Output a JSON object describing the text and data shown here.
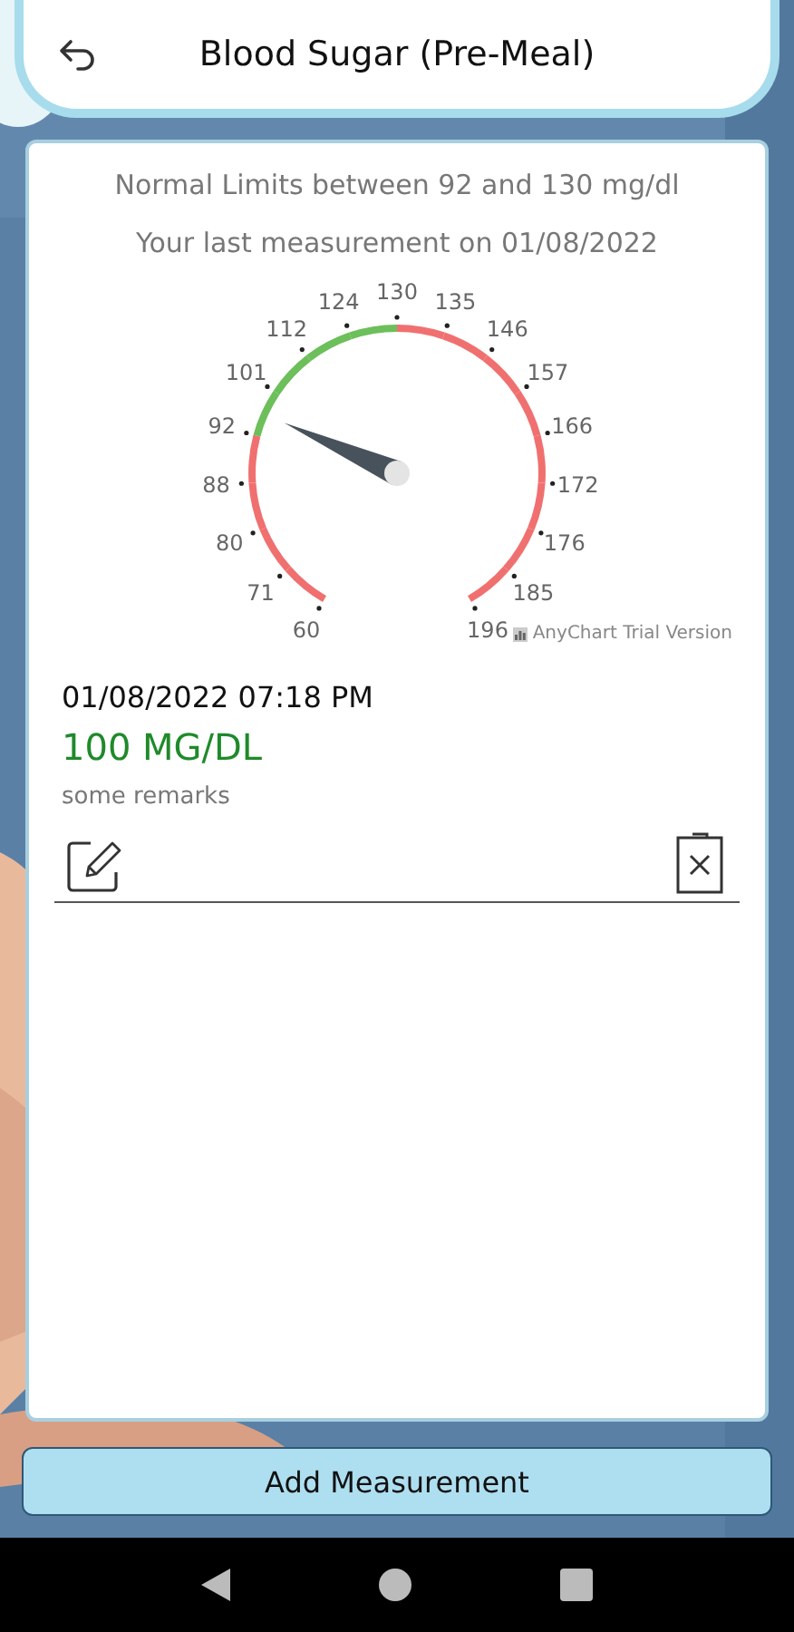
{
  "header": {
    "title": "Blood Sugar (Pre-Meal)"
  },
  "card": {
    "limits_text": "Normal Limits between 92 and 130 mg/dl",
    "last_text": "Your last measurement on 01/08/2022",
    "gauge": {
      "credit": "AnyChart Trial Version",
      "ticks": [
        {
          "label": "60",
          "normal": false
        },
        {
          "label": "71",
          "normal": false
        },
        {
          "label": "80",
          "normal": false
        },
        {
          "label": "88",
          "normal": false
        },
        {
          "label": "92",
          "normal": true
        },
        {
          "label": "101",
          "normal": true
        },
        {
          "label": "112",
          "normal": true
        },
        {
          "label": "124",
          "normal": true
        },
        {
          "label": "130",
          "normal": false
        },
        {
          "label": "135",
          "normal": false
        },
        {
          "label": "146",
          "normal": false
        },
        {
          "label": "157",
          "normal": false
        },
        {
          "label": "166",
          "normal": false
        },
        {
          "label": "172",
          "normal": false
        },
        {
          "label": "176",
          "normal": false
        },
        {
          "label": "185",
          "normal": false
        },
        {
          "label": "196"
        }
      ]
    },
    "entries": [
      {
        "datetime": "01/08/2022 07:18 PM",
        "value": "100 MG/DL",
        "remarks": "some remarks"
      }
    ]
  },
  "add_button": "Add Measurement"
}
